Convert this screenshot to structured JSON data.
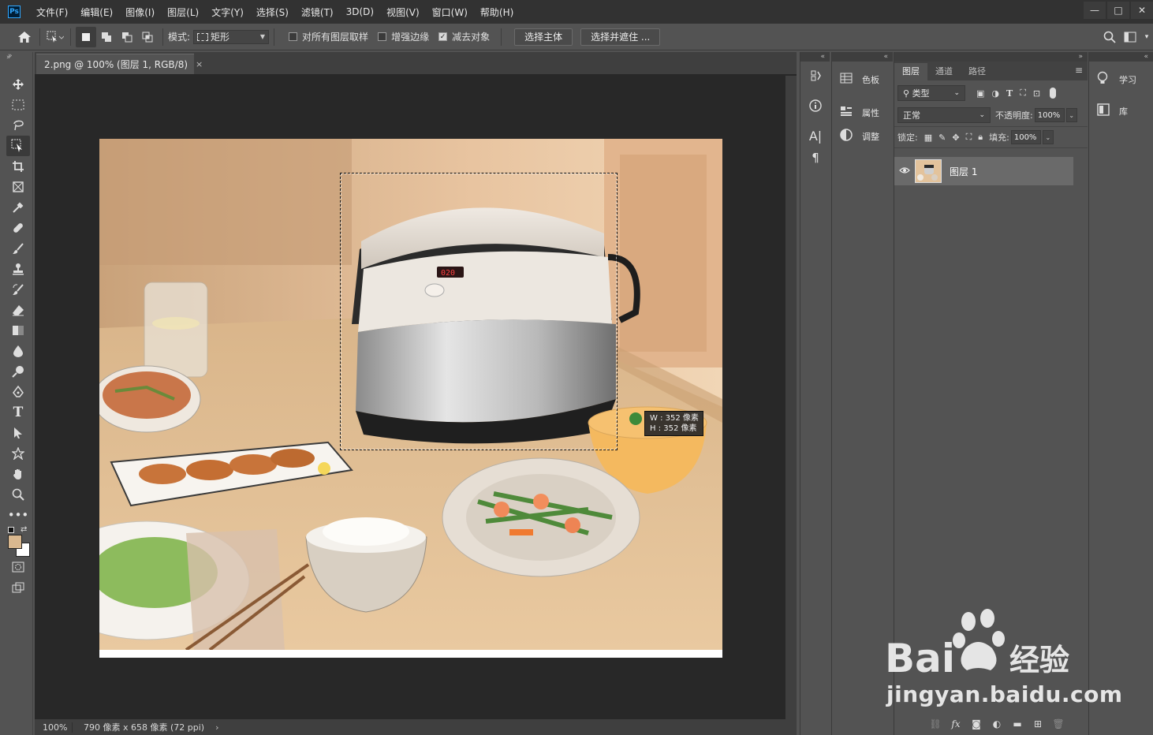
{
  "app": {
    "logo": "Ps"
  },
  "menu": [
    "文件(F)",
    "编辑(E)",
    "图像(I)",
    "图层(L)",
    "文字(Y)",
    "选择(S)",
    "滤镜(T)",
    "3D(D)",
    "视图(V)",
    "窗口(W)",
    "帮助(H)"
  ],
  "window_controls": {
    "minimize": "—",
    "maximize": "□",
    "close": "✕"
  },
  "options": {
    "mode_label": "模式:",
    "mode_value": "矩形",
    "sample_all_layers": {
      "label": "对所有图层取样",
      "checked": false
    },
    "enhance_edge": {
      "label": "增强边缘",
      "checked": false
    },
    "subtract_object": {
      "label": "减去对象",
      "checked": true
    },
    "select_subject": "选择主体",
    "select_and_mask": "选择并遮住 ..."
  },
  "document": {
    "tab_title": "2.png @ 100% (图层 1, RGB/8)",
    "tab_close": "×",
    "zoom": "100%",
    "info": "790 像素 x 658 像素 (72 ppi)",
    "status_arrow": "›"
  },
  "selection_tooltip": {
    "w": "W :  352 像素",
    "h": "H :  352 像素"
  },
  "side_panels": [
    {
      "icon": "swatches-icon",
      "label": "色板"
    },
    {
      "icon": "properties-icon",
      "label": "属性"
    },
    {
      "icon": "adjustments-icon",
      "label": "调整"
    }
  ],
  "learn_panels": [
    {
      "icon": "bulb-icon",
      "label": "学习"
    },
    {
      "icon": "library-icon",
      "label": "库"
    }
  ],
  "layers_panel": {
    "tabs": [
      "图层",
      "通道",
      "路径"
    ],
    "active_tab": "图层",
    "filter_kind": "类型",
    "blend_mode": "正常",
    "opacity_label": "不透明度:",
    "opacity_value": "100%",
    "lock_label": "锁定:",
    "fill_label": "填充:",
    "fill_value": "100%",
    "layers": [
      {
        "name": "图层 1",
        "visible": true
      }
    ]
  },
  "watermark": {
    "brand": "Bai",
    "brand_suffix": "经验",
    "url": "jingyan.baidu.com"
  },
  "colors": {
    "foreground": "#d9b88f",
    "background": "#ffffff",
    "accent": "#31a8ff"
  }
}
